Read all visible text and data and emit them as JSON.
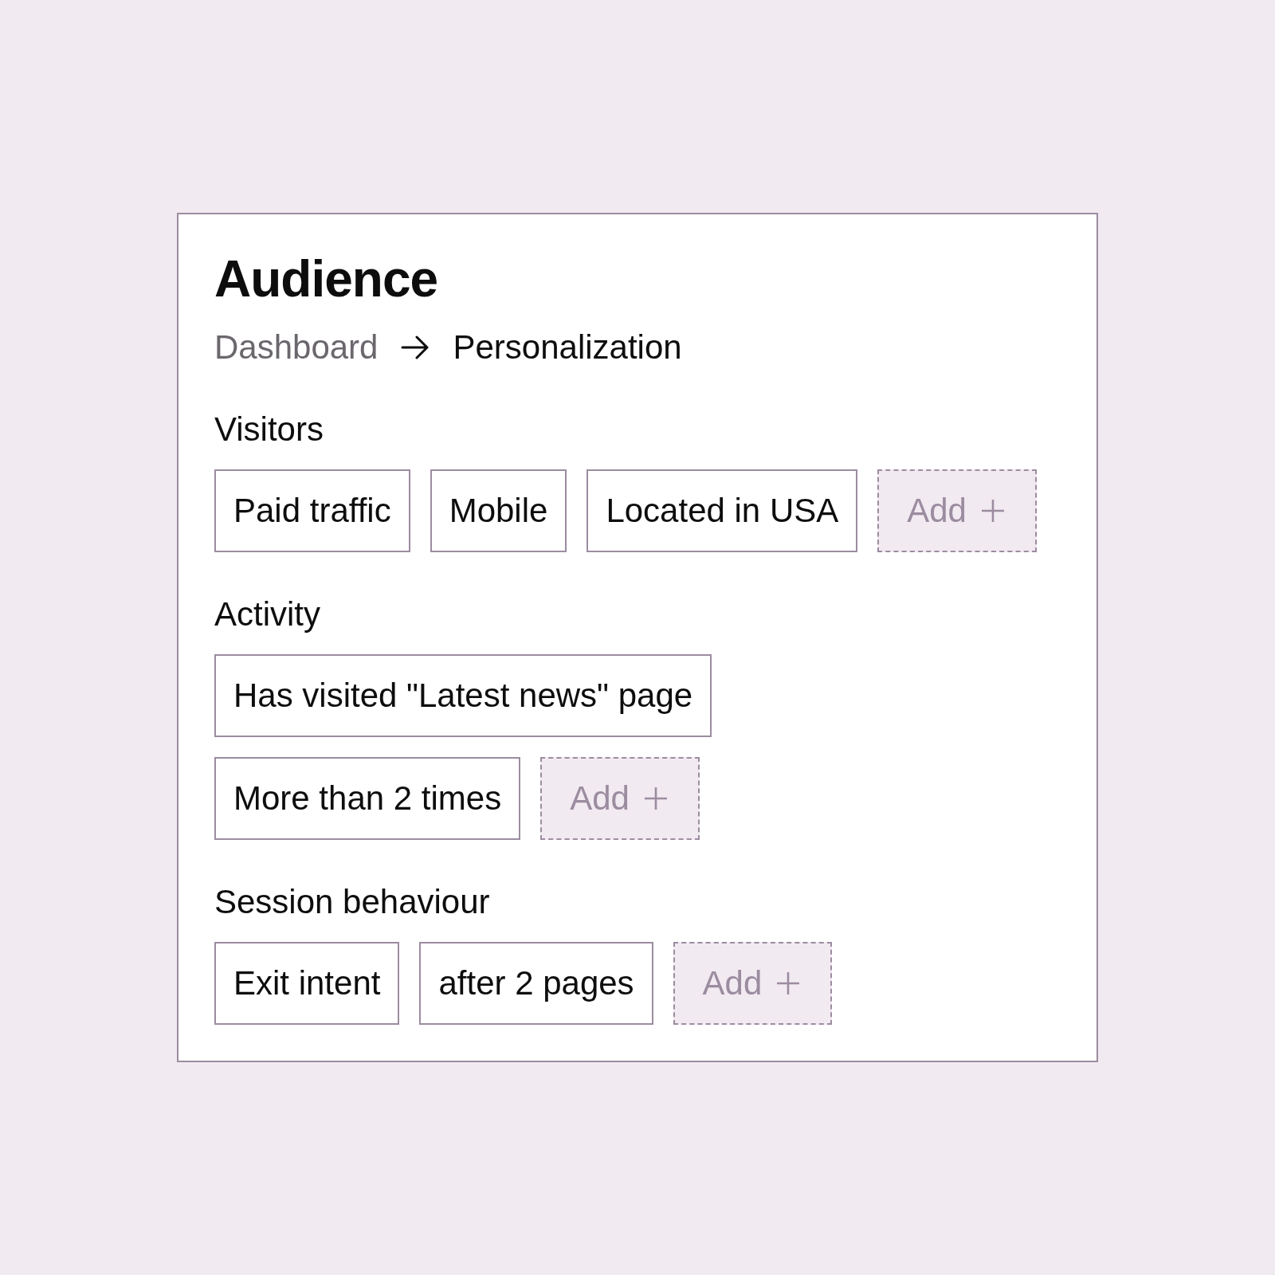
{
  "card": {
    "title": "Audience",
    "breadcrumb": [
      {
        "label": "Dashboard",
        "current": false
      },
      {
        "label": "Personalization",
        "current": true
      }
    ],
    "sections": [
      {
        "label": "Visitors",
        "rows": [
          {
            "items": [
              {
                "kind": "chip",
                "label": "Paid traffic"
              },
              {
                "kind": "chip",
                "label": "Mobile"
              },
              {
                "kind": "chip",
                "label": "Located in USA"
              },
              {
                "kind": "add",
                "label": "Add"
              }
            ]
          }
        ]
      },
      {
        "label": "Activity",
        "rows": [
          {
            "items": [
              {
                "kind": "chip",
                "label": "Has visited \"Latest news\" page"
              }
            ]
          },
          {
            "items": [
              {
                "kind": "chip",
                "label": "More than 2 times"
              },
              {
                "kind": "add",
                "label": "Add"
              }
            ]
          }
        ]
      },
      {
        "label": "Session behaviour",
        "rows": [
          {
            "items": [
              {
                "kind": "chip",
                "label": "Exit intent"
              },
              {
                "kind": "chip",
                "label": "after 2 pages"
              },
              {
                "kind": "add",
                "label": "Add"
              }
            ]
          }
        ]
      }
    ]
  }
}
